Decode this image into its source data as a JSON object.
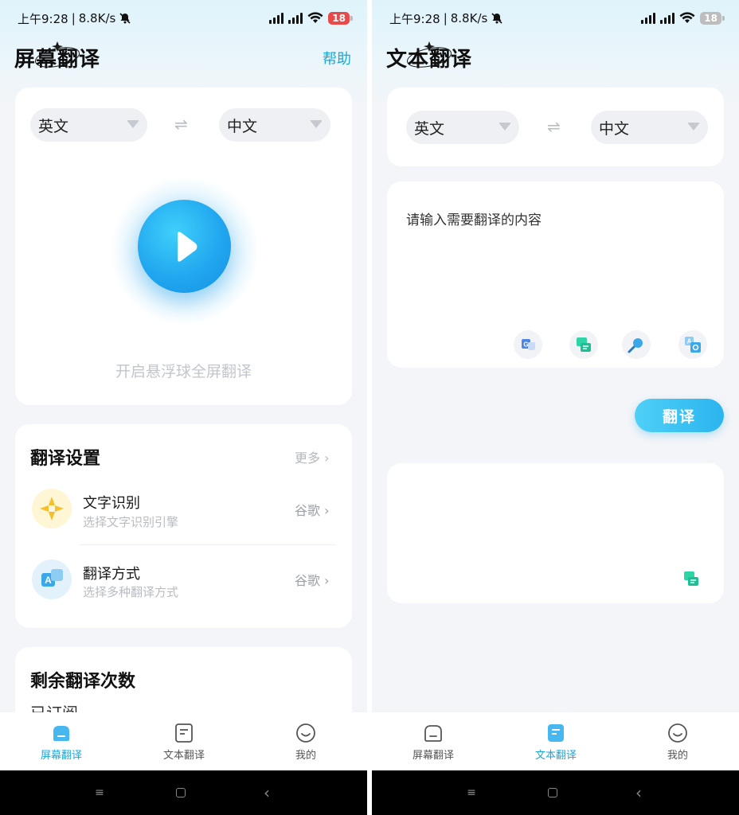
{
  "status_bar": {
    "time": "上午9:28",
    "speed": "8.8K/s",
    "battery": "18"
  },
  "screen_translate": {
    "title": "屏幕翻译",
    "help": "帮助",
    "source_lang": "英文",
    "target_lang": "中文",
    "swap_symbol": "⇌",
    "start_hint": "开启悬浮球全屏翻译",
    "settings": {
      "title": "翻译设置",
      "more": "更多",
      "items": [
        {
          "title": "文字识别",
          "subtitle": "选择文字识别引擎",
          "value": "谷歌"
        },
        {
          "title": "翻译方式",
          "subtitle": "选择多种翻译方式",
          "value": "谷歌"
        }
      ]
    },
    "remaining": {
      "title": "剩余翻译次数",
      "subscribed": "已订阅"
    }
  },
  "text_translate": {
    "title": "文本翻译",
    "source_lang": "英文",
    "target_lang": "中文",
    "swap_symbol": "⇌",
    "input_placeholder": "请输入需要翻译的内容",
    "translate_button": "翻译",
    "tools": [
      "google-translate-icon",
      "chat-translate-icon",
      "search-icon",
      "image-translate-icon"
    ]
  },
  "nav": {
    "items": [
      {
        "label": "屏幕翻译",
        "icon": "home-icon"
      },
      {
        "label": "文本翻译",
        "icon": "document-icon"
      },
      {
        "label": "我的",
        "icon": "smile-icon"
      }
    ]
  },
  "system_nav": {
    "menu": "≡",
    "back": "‹"
  },
  "colors": {
    "accent": "#1aa7d8",
    "background": "#f3f5f8",
    "card": "#ffffff"
  }
}
